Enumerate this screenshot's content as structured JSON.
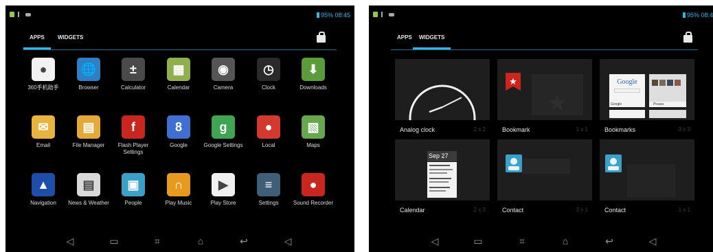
{
  "left_screen": {
    "status": {
      "battery": "95%",
      "time": "08:45"
    },
    "tabs": [
      {
        "label": "APPS",
        "active": true
      },
      {
        "label": "WIDGETS",
        "active": false
      }
    ],
    "apps": [
      {
        "label": "360手机助手",
        "icon": "360-assistant-icon",
        "color": "#f2f2f2"
      },
      {
        "label": "Browser",
        "icon": "globe-icon",
        "color": "#2f7fc4"
      },
      {
        "label": "Calculator",
        "icon": "calculator-icon",
        "color": "#4a4a4a"
      },
      {
        "label": "Calendar",
        "icon": "calendar-icon",
        "color": "#8fb04c"
      },
      {
        "label": "Camera",
        "icon": "camera-icon",
        "color": "#555555"
      },
      {
        "label": "Clock",
        "icon": "clock-icon",
        "color": "#2a2a2a"
      },
      {
        "label": "Downloads",
        "icon": "download-icon",
        "color": "#5a9b3a"
      },
      {
        "label": "Email",
        "icon": "envelope-icon",
        "color": "#e8b440"
      },
      {
        "label": "File Manager",
        "icon": "folder-icon",
        "color": "#e5a93a"
      },
      {
        "label": "Flash Player Settings",
        "icon": "flash-icon",
        "color": "#c8261f"
      },
      {
        "label": "Google",
        "icon": "google-icon",
        "color": "#3f6fd0"
      },
      {
        "label": "Google Settings",
        "icon": "google-settings-icon",
        "color": "#3fa553"
      },
      {
        "label": "Local",
        "icon": "map-pin-icon",
        "color": "#d33a2f"
      },
      {
        "label": "Maps",
        "icon": "map-icon",
        "color": "#67a84d"
      },
      {
        "label": "Navigation",
        "icon": "navigation-arrow-icon",
        "color": "#1e4fa8"
      },
      {
        "label": "News & Weather",
        "icon": "newspaper-icon",
        "color": "#d9d9d9"
      },
      {
        "label": "People",
        "icon": "contact-card-icon",
        "color": "#3ba1c9"
      },
      {
        "label": "Play Music",
        "icon": "headphones-icon",
        "color": "#e89a1e"
      },
      {
        "label": "Play Store",
        "icon": "shopping-bag-icon",
        "color": "#f0f0f0"
      },
      {
        "label": "Settings",
        "icon": "sliders-icon",
        "color": "#3f5f78"
      },
      {
        "label": "Sound Recorder",
        "icon": "microphone-icon",
        "color": "#c8261f"
      }
    ],
    "glyphs": [
      "●",
      "🌐",
      "±",
      "▦",
      "◉",
      "◷",
      "⬇",
      "✉",
      "▤",
      "f",
      "8",
      "g",
      "●",
      "▧",
      "▲",
      "▤",
      "▣",
      "∩",
      "▶",
      "≡",
      "●"
    ]
  },
  "right_screen": {
    "status": {
      "battery": "95%",
      "time": "08:4"
    },
    "tabs": [
      {
        "label": "APPS",
        "active": false
      },
      {
        "label": "WIDGETS",
        "active": true
      }
    ],
    "widgets": [
      {
        "name": "Analog clock",
        "size": "2 x 2"
      },
      {
        "name": "Bookmark",
        "size": "1 x 1"
      },
      {
        "name": "Bookmarks",
        "size": "3 x 3"
      },
      {
        "name": "Calendar",
        "size": "2 x 3"
      },
      {
        "name": "Contact",
        "size": "3 x 1"
      },
      {
        "name": "Contact",
        "size": "1 x 1"
      }
    ],
    "calendar_preview": {
      "header": "Sep 27"
    },
    "bookmarks_preview": {
      "logo": "Google",
      "caption_a": "Google",
      "caption_b": "Picasa"
    }
  },
  "navbar": [
    {
      "name": "volume-down-icon",
      "glyph": "◁"
    },
    {
      "name": "recent-apps-icon",
      "glyph": "▭"
    },
    {
      "name": "screenshot-icon",
      "glyph": "⌗"
    },
    {
      "name": "home-icon",
      "glyph": "⌂"
    },
    {
      "name": "back-icon",
      "glyph": "↩"
    },
    {
      "name": "volume-up-icon",
      "glyph": "◁"
    }
  ]
}
